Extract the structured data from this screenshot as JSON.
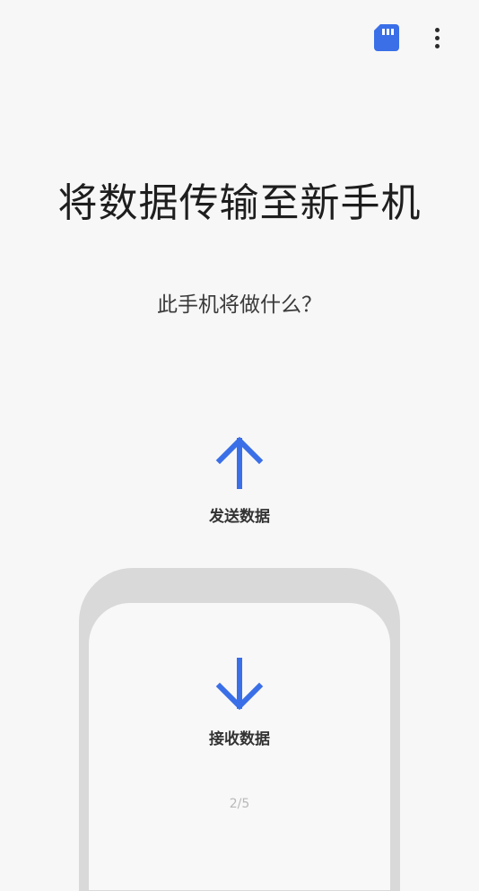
{
  "header": {
    "sd_icon": "sd-card-icon",
    "more_icon": "more-vert-icon"
  },
  "title": "将数据传输至新手机",
  "subtitle": "此手机将做什么？",
  "actions": {
    "send": {
      "label": "发送数据",
      "icon": "arrow-up-icon"
    },
    "receive": {
      "label": "接收数据",
      "icon": "arrow-down-icon"
    }
  },
  "page_indicator": "2/5",
  "colors": {
    "accent": "#3a6fe8",
    "background": "#f7f7f7",
    "phone_frame": "#d9d9d9"
  }
}
